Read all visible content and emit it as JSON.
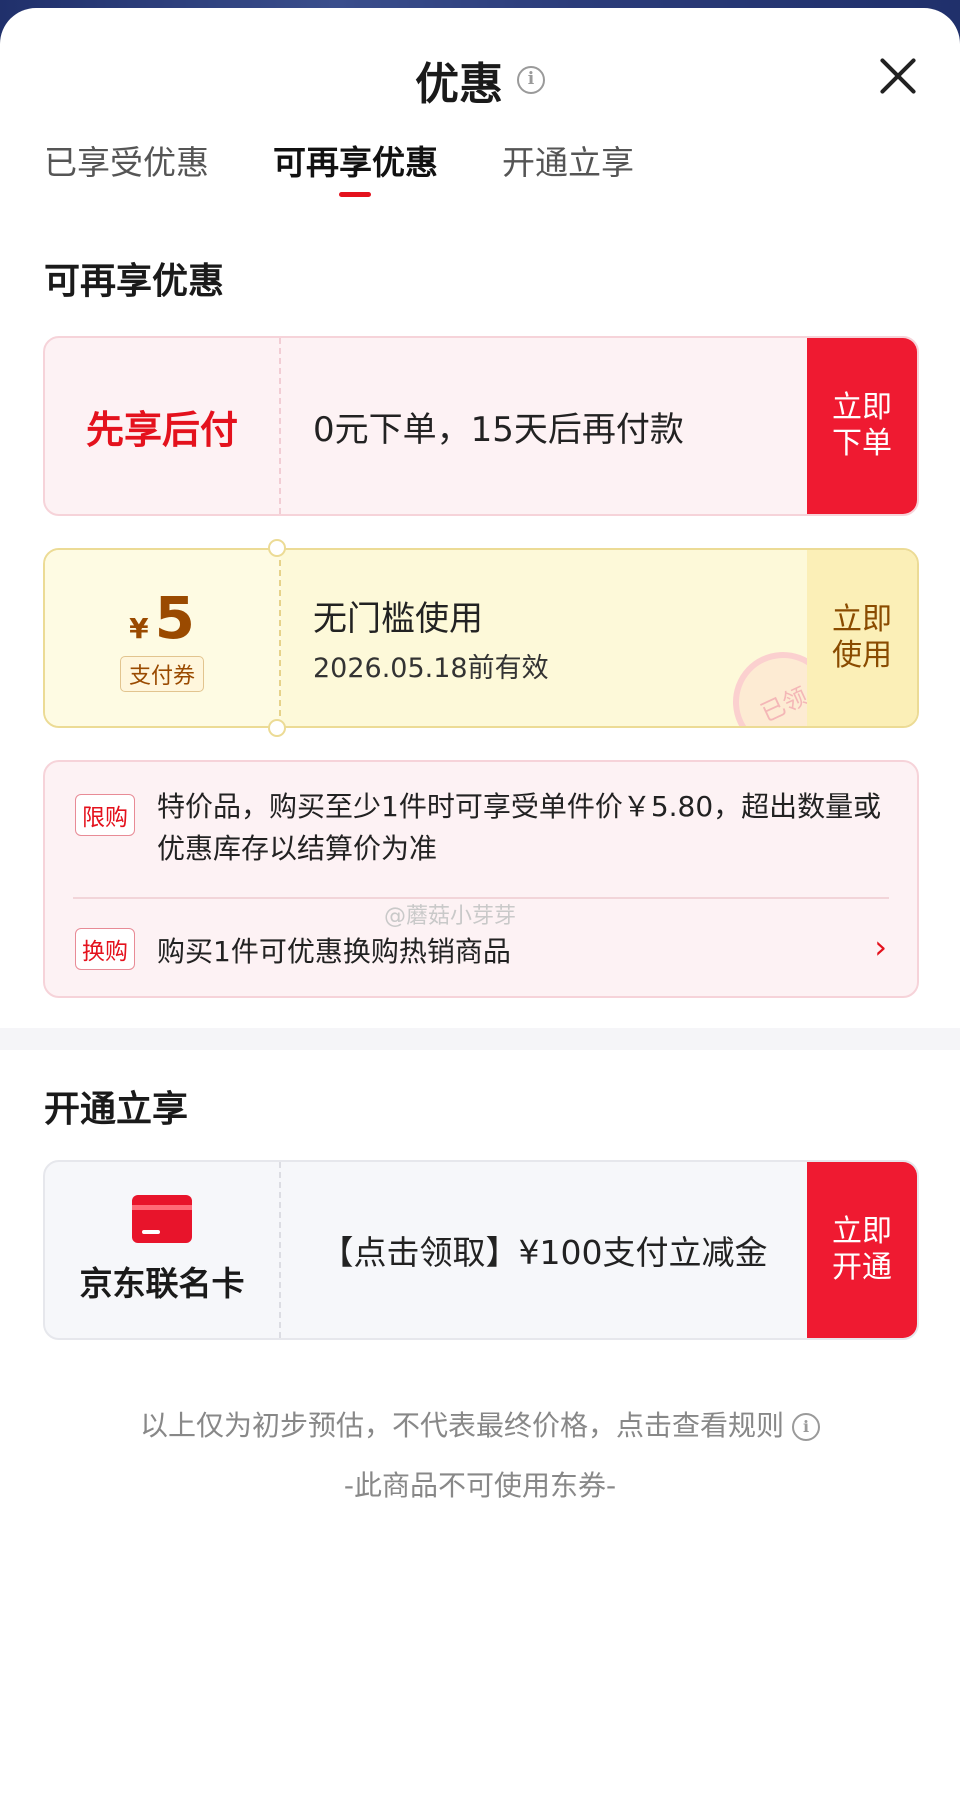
{
  "header": {
    "title": "优惠"
  },
  "tabs": [
    {
      "label": "已享受优惠"
    },
    {
      "label": "可再享优惠",
      "active": true
    },
    {
      "label": "开通立享"
    }
  ],
  "sections": {
    "reenjoy_title": "可再享优惠",
    "open_title": "开通立享"
  },
  "card_bnpl": {
    "label": "先享后付",
    "text": "0元下单，15天后再付款",
    "action_line1": "立即",
    "action_line2": "下单"
  },
  "card_coupon": {
    "currency": "¥",
    "amount": "5",
    "badge": "支付券",
    "title": "无门槛使用",
    "validity": "2026.05.18前有效",
    "stamp": "已领",
    "action_line1": "立即",
    "action_line2": "使用"
  },
  "info_card": {
    "tag1": "限购",
    "text1": "特价品，购买至少1件时可享受单件价￥5.80，超出数量或优惠库存以结算价为准",
    "tag2": "换购",
    "text2": "购买1件可优惠换购热销商品"
  },
  "watermark": "@蘑菇小芽芽",
  "card_jd": {
    "name": "京东联名卡",
    "text": "【点击领取】¥100支付立减金",
    "action_line1": "立即",
    "action_line2": "开通"
  },
  "footer": {
    "line1": "以上仅为初步预估，不代表最终价格，点击查看规则",
    "line2": "-此商品不可使用东券-"
  },
  "colors": {
    "accent_red": "#e4121d",
    "button_red": "#ef1a31",
    "coupon_brown": "#9a4a00"
  }
}
